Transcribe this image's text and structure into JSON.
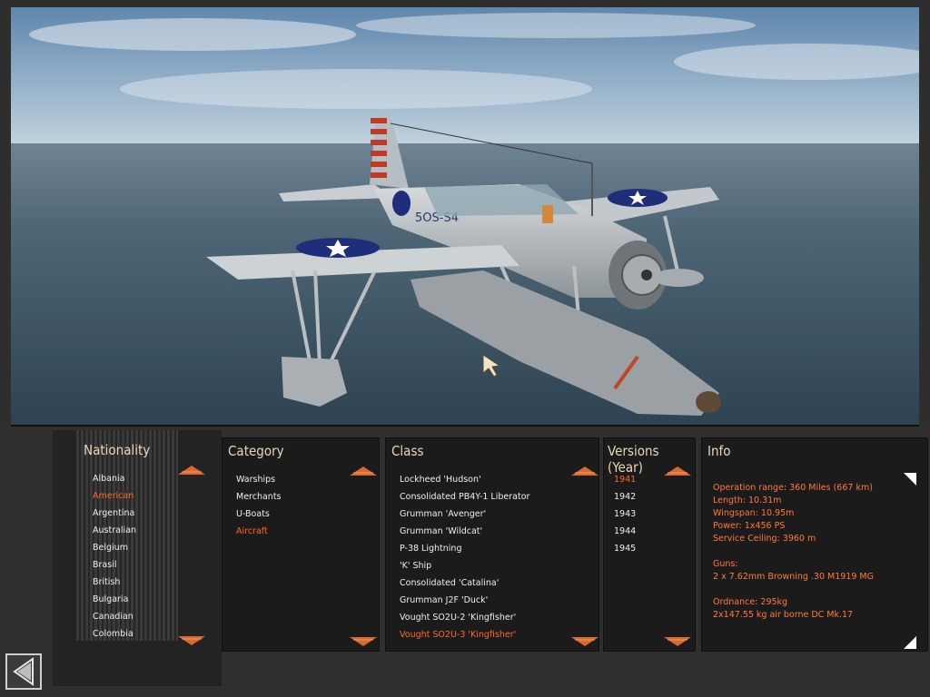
{
  "panels": {
    "nationality": {
      "title": "Nationality",
      "items": [
        "Albania",
        "American",
        "Argentina",
        "Australian",
        "Belgium",
        "Brasil",
        "British",
        "Bulgaria",
        "Canadian",
        "Colombia"
      ],
      "selected_index": 1
    },
    "category": {
      "title": "Category",
      "items": [
        "Warships",
        "Merchants",
        "U-Boats",
        "Aircraft"
      ],
      "selected_index": 3
    },
    "class": {
      "title": "Class",
      "items": [
        "Lockheed 'Hudson'",
        "Consolidated PB4Y-1 Liberator",
        "Grumman 'Avenger'",
        "Grumman 'Wildcat'",
        "P-38 Lightning",
        "'K' Ship",
        "Consolidated 'Catalina'",
        "Grumman J2F 'Duck'",
        "Vought SO2U-2 'Kingfisher'",
        "Vought SO2U-3 'Kingfisher'"
      ],
      "selected_index": 9
    },
    "versions": {
      "title": "Versions (Year)",
      "items": [
        "1941",
        "1942",
        "1943",
        "1944",
        "1945"
      ],
      "selected_index": 0
    },
    "info": {
      "title": "Info",
      "lines": [
        "Operation range: 360 Miles (667 km)",
        "Length: 10.31m",
        "Wingspan: 10.95m",
        "Power: 1x456 PS",
        "Service Ceiling: 3960 m",
        "",
        "Guns:",
        "2 x 7.62mm Browning .30 M1919 MG",
        "",
        "Ordnance: 295kg",
        "2x147.55 kg air borne DC Mk.17"
      ]
    }
  },
  "aircraft": {
    "fuselage_code": "5OS-S4"
  },
  "colors": {
    "accent": "#ff6a2a",
    "arrow": "#d9692e",
    "title": "#e8d9b8",
    "text": "#f2efe8"
  },
  "icons": {
    "scroll_up": "triangle-up-icon",
    "scroll_down": "triangle-down-icon",
    "back": "back-arrow-icon",
    "expand": "corner-triangle-icon"
  }
}
